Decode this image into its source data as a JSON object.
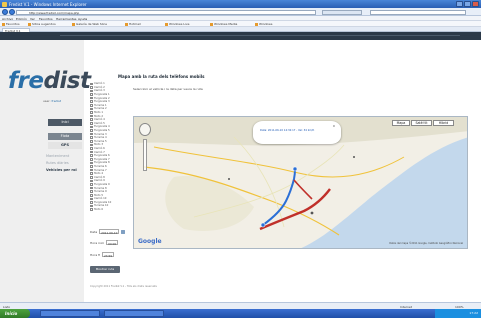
{
  "browser": {
    "window_title": "Fredist V.1 - Windows Internet Explorer",
    "address": "http://www.fredist.com/mapa.php",
    "menu": [
      "Archivo",
      "Edición",
      "Ver",
      "Favoritos",
      "Herramientas",
      "Ayuda"
    ],
    "favorites": [
      "Favoritos",
      "Sitios sugeridos",
      "Galería de Web Slice",
      "Hotmail",
      "Windows Live",
      "Windows Media",
      "Windows"
    ],
    "tab": "Fredist V.1",
    "status_left": "Listo",
    "status_right": "Internet",
    "zoom": "100%"
  },
  "sidebar": {
    "logo_a": "fre",
    "logo_b": "dist",
    "user_prefix": "user:",
    "user_name": "fredist",
    "buttons": [
      "Inici",
      "Flota",
      "GPS"
    ],
    "links": [
      "Manteniment",
      "Rutes diàries",
      "Vehicles per rol"
    ]
  },
  "page": {
    "heading": "Mapa amb la ruta dels telèfons mobils",
    "info": "Seleccioni el vehicle i la data per veure la ruta"
  },
  "vehicles": [
    "Camió 1",
    "Camió 2",
    "Camió 3",
    "Furgoneta 1",
    "Furgoneta 2",
    "Furgoneta 3",
    "Turisme 1",
    "Turisme 2",
    "Moto 1",
    "Moto 2",
    "Camió 4",
    "Camió 5",
    "Furgoneta 4",
    "Furgoneta 5",
    "Turisme 3",
    "Turisme 4",
    "Turisme 5",
    "Moto 3",
    "Camió 6",
    "Camió 7",
    "Furgoneta 6",
    "Furgoneta 7",
    "Furgoneta 8",
    "Turisme 6",
    "Turisme 7",
    "Moto 4",
    "Camió 8",
    "Camió 9",
    "Furgoneta 9",
    "Turisme 8",
    "Turisme 9",
    "Moto 5",
    "Camió 10",
    "Furgoneta 10",
    "Turisme 10",
    "Moto 6"
  ],
  "form": {
    "date_label": "Data",
    "date_value": "2011-06-10",
    "from_label": "Hora inici",
    "from_value": "00:00",
    "to_label": "Hora fi",
    "to_value": "23:59",
    "submit_label": "Mostrar ruta"
  },
  "map": {
    "types": [
      "Mapa",
      "Satèl·lit",
      "Híbrid"
    ],
    "bubble_text": "Data: 2011-06-10 14:32:17 - Vel: 34 km/h",
    "close": "x",
    "google": "Google",
    "copyright": "Datos del mapa ©2011 Google, Instituto Geográfico Nacional",
    "colors": {
      "water": "#c3d8ec",
      "land": "#f2efe6",
      "route": "#c0302a",
      "route_blue": "#2b6fd6"
    }
  },
  "footer": "Copyright 2011 Fredist V.1 - Tots els drets reservats",
  "taskbar": {
    "start": "Inicio",
    "clock": "17:22"
  }
}
